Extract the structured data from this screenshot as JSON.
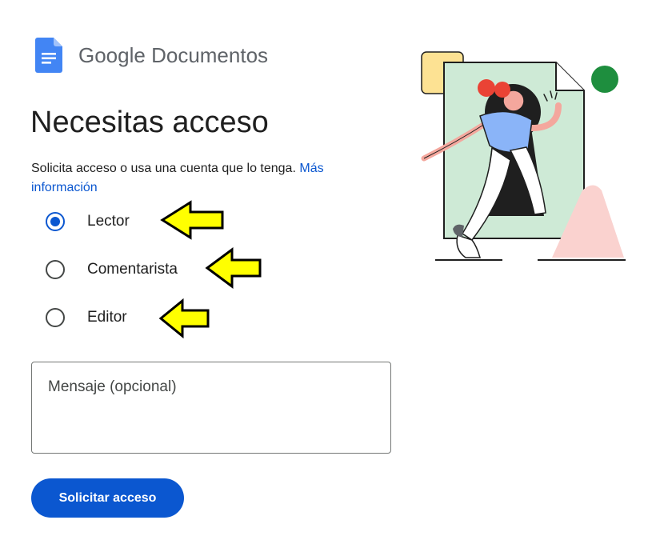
{
  "header": {
    "brand_google": "Google",
    "brand_product": "Documentos",
    "logo_icon": "google-docs-icon"
  },
  "main": {
    "title": "Necesitas acceso",
    "description": "Solicita acceso o usa una cuenta que lo tenga.",
    "learn_more_label": "Más información",
    "roles": [
      {
        "label": "Lector",
        "checked": true
      },
      {
        "label": "Comentarista",
        "checked": false
      },
      {
        "label": "Editor",
        "checked": false
      }
    ],
    "message_placeholder": "Mensaje (opcional)",
    "message_value": "",
    "submit_label": "Solicitar acceso"
  },
  "annotations": {
    "arrow_icon": "left-arrow-icon",
    "arrow_color": "#ffff00"
  },
  "colors": {
    "accent": "#0b57d0",
    "text": "#1f1f1f",
    "docs_blue": "#4285f4"
  }
}
